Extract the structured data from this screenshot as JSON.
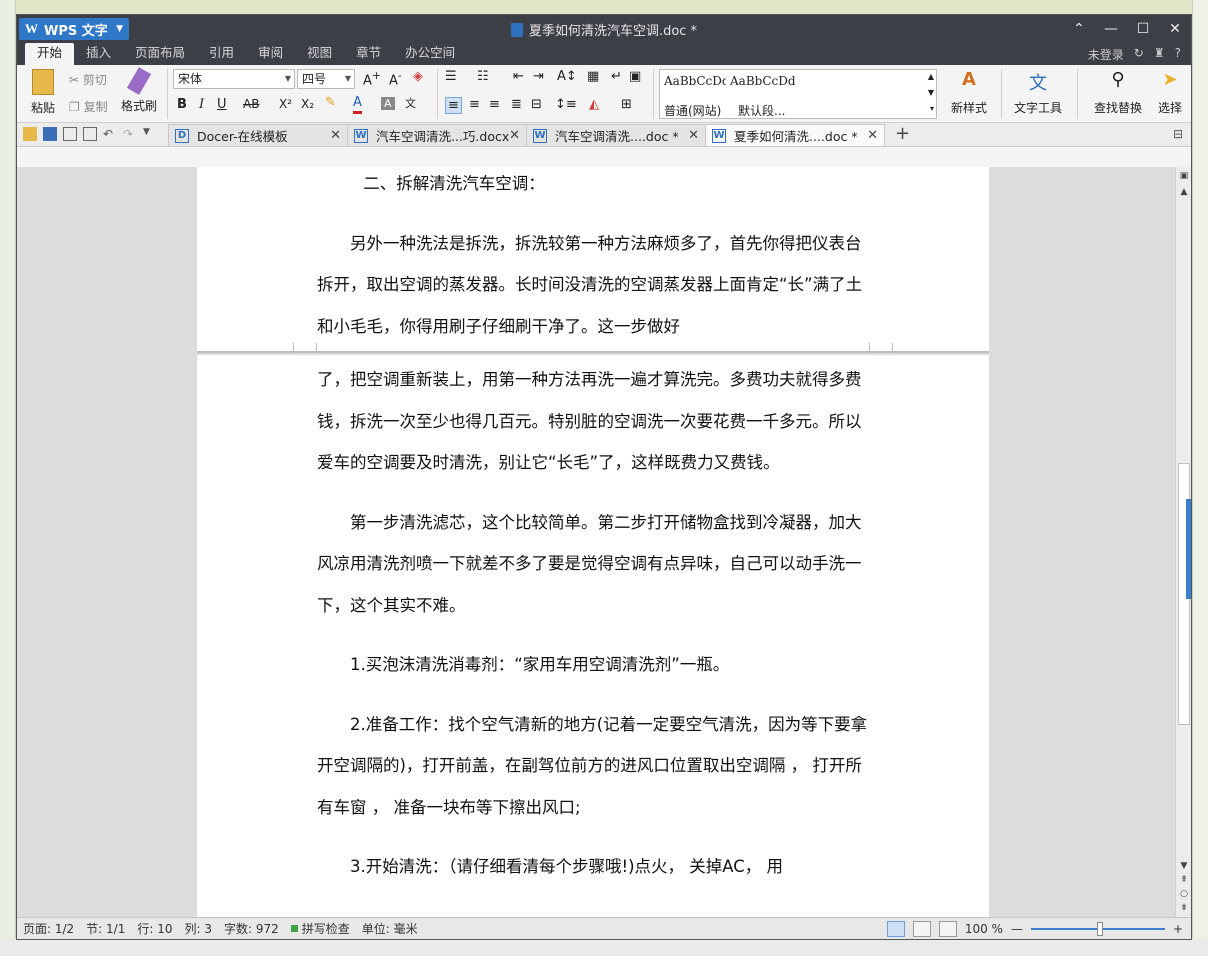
{
  "window": {
    "app_name": "WPS 文字",
    "doc_title": "夏季如何清洗汽车空调.doc *",
    "controls": [
      "⌃",
      "—",
      "☐",
      "✕"
    ]
  },
  "menu": {
    "tabs": [
      "开始",
      "插入",
      "页面布局",
      "引用",
      "审阅",
      "视图",
      "章节",
      "办公空间"
    ],
    "login": "未登录",
    "help": "?"
  },
  "ribbon": {
    "paste": "粘贴",
    "cut": "剪切",
    "copy": "复制",
    "format_painter": "格式刷",
    "font_name": "宋体",
    "font_size": "四号",
    "bold": "B",
    "italic": "I",
    "underline": "U",
    "strike": "AB",
    "superscript": "X²",
    "subscript": "X₂",
    "styles": [
      {
        "preview": "AaBbCcDd",
        "label": "普通(网站)"
      },
      {
        "preview": "AaBbCcDd",
        "label": "默认段..."
      }
    ],
    "new_style": "新样式",
    "text_tools": "文字工具",
    "find_replace": "查找替换",
    "select": "选择"
  },
  "doc_tabs": [
    {
      "label": "Docer-在线模板",
      "icon": "D"
    },
    {
      "label": "汽车空调清洗...巧.docx",
      "icon": "W"
    },
    {
      "label": "汽车空调清洗....doc *",
      "icon": "W"
    },
    {
      "label": "夏季如何清洗....doc *",
      "icon": "W"
    }
  ],
  "document": {
    "page1": [
      {
        "type": "heading",
        "text": "二、拆解清洗汽车空调："
      },
      {
        "type": "para",
        "text": "另外一种洗法是拆洗，拆洗较第一种方法麻烦多了，首先你得把仪表台拆开，取出空调的蒸发器。长时间没清洗的空调蒸发器上面肯定“长”满了土和小毛毛，你得用刷子仔细刷干净了。这一步做好"
      }
    ],
    "page2": [
      {
        "type": "cont",
        "text": "了，把空调重新装上，用第一种方法再洗一遍才算洗完。多费功夫就得多费钱，拆洗一次至少也得几百元。特别脏的空调洗一次要花费一千多元。所以爱车的空调要及时清洗，别让它“长毛”了，这样既费力又费钱。"
      },
      {
        "type": "para",
        "text": "第一步清洗滤芯，这个比较简单。第二步打开储物盒找到冷凝器，加大风凉用清洗剂喷一下就差不多了要是觉得空调有点异味，自己可以动手洗一下，这个其实不难。"
      },
      {
        "type": "para",
        "text": "1.买泡沫清洗消毒剂：“家用车用空调清洗剂”一瓶。"
      },
      {
        "type": "para",
        "text": "2.准备工作：找个空气清新的地方(记着一定要空气清洗，因为等下要拿开空调隔的)，打开前盖，在副驾位前方的进风口位置取出空调隔 ，  打开所有车窗 ，  准备一块布等下擦出风口;"
      },
      {
        "type": "para",
        "text": "3.开始清洗：（请仔细看清每个步骤哦!)点火，  关掉AC，  用"
      }
    ]
  },
  "status": {
    "page": "页面: 1/2",
    "section": "节: 1/1",
    "line": "行: 10",
    "column": "列: 3",
    "word_count": "字数: 972",
    "spell_check": "拼写检查",
    "unit": "单位: 毫米",
    "zoom": "100 %",
    "zoom_out": "—",
    "zoom_in": "+"
  }
}
